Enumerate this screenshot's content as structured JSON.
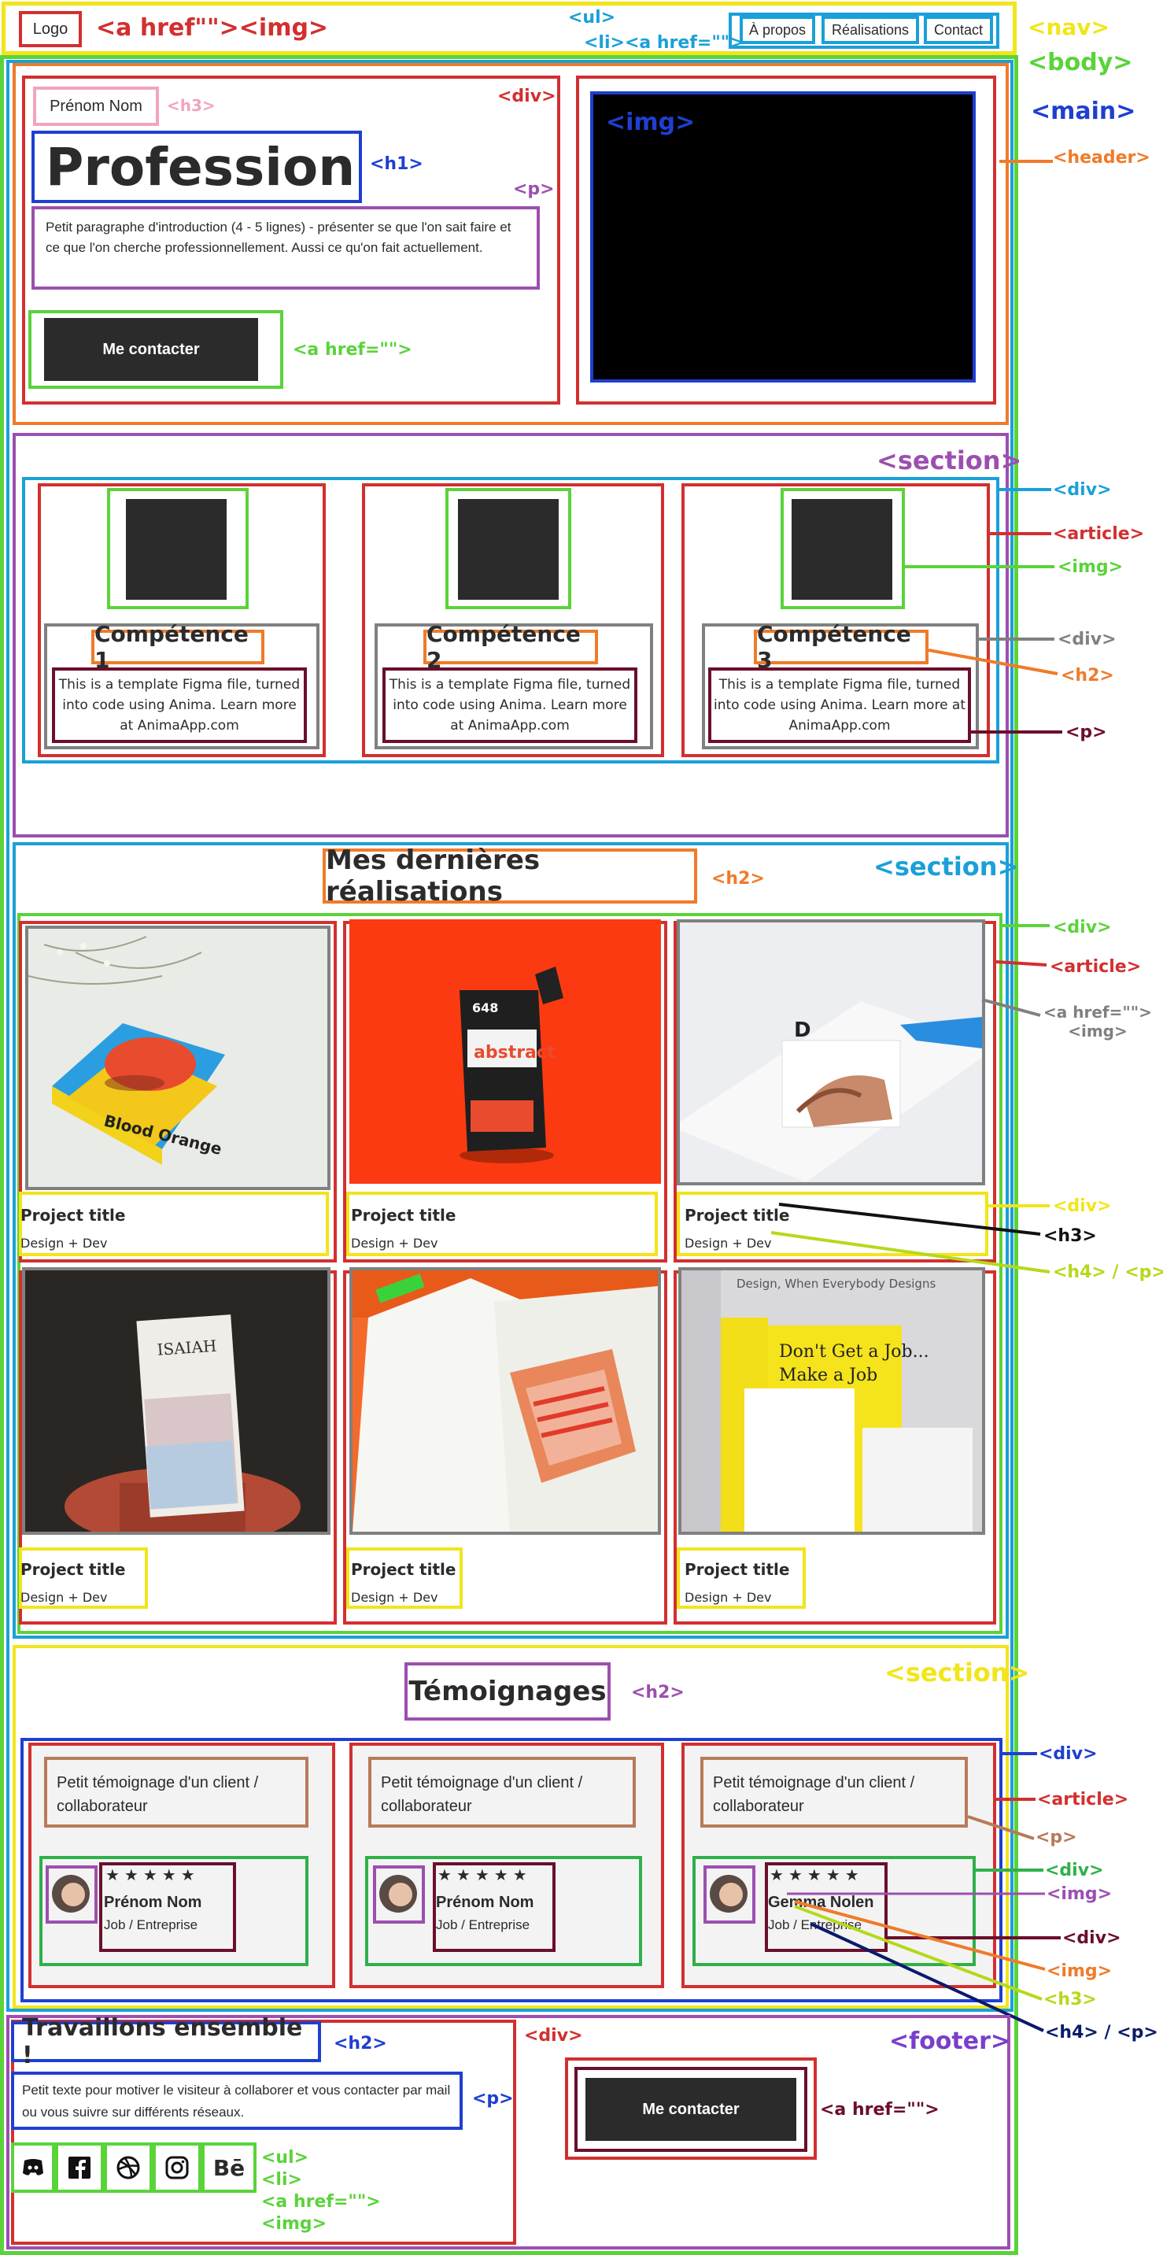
{
  "nav": {
    "logo": "Logo",
    "logo_tag": "<a href\"\"><img>",
    "ul_tag": "<ul>",
    "li_tag": "<li><a href=\"\">",
    "links": [
      "À propos",
      "Réalisations",
      "Contact"
    ],
    "nav_tag": "<nav>",
    "body_tag": "<body>",
    "main_tag": "<main>",
    "header_tag": "<header>"
  },
  "header": {
    "name": "Prénom Nom",
    "h3_tag": "<h3>",
    "div_tag": "<div>",
    "profession": "Profession",
    "h1_tag": "<h1>",
    "p_tag": "<p>",
    "intro": "Petit paragraphe d'introduction (4 - 5 lignes) - présenter se que l'on sait faire et ce que l'on cherche professionnellement. Aussi ce qu'on fait actuellement.",
    "cta": "Me contacter",
    "cta_tag": "<a href=\"\">",
    "img_tag": "<img>"
  },
  "skills": {
    "section_tag": "<section>",
    "div_tag": "<div>",
    "article_tag": "<article>",
    "img_tag": "<img>",
    "inner_div_tag": "<div>",
    "h2_tag": "<h2>",
    "p_tag": "<p>",
    "items": [
      {
        "title": "Compétence 1",
        "text": "This is a template Figma file, turned into code using Anima. Learn more at AnimaApp.com"
      },
      {
        "title": "Compétence 2",
        "text": "This is a template Figma file, turned into code using Anima. Learn more at AnimaApp.com"
      },
      {
        "title": "Compétence 3",
        "text": "This is a template Figma file, turned into code using Anima. Learn more at AnimaApp.com"
      }
    ]
  },
  "works": {
    "title": "Mes dernières réalisations",
    "h2_tag": "<h2>",
    "section_tag": "<section>",
    "div_tag": "<div>",
    "article_tag": "<article>",
    "link_img_tag": "<a href=\"\">\n<img>",
    "info_div_tag": "<div>",
    "h3_tag": "<h3>",
    "h4p_tag": "<h4> / <p>",
    "projects": [
      {
        "title": "Project title",
        "sub": "Design + Dev",
        "photo": "blood-orange-book"
      },
      {
        "title": "Project title",
        "sub": "Design + Dev",
        "photo": "abstract-paint-pouch"
      },
      {
        "title": "Project title",
        "sub": "Design + Dev",
        "photo": "hand-on-paper"
      },
      {
        "title": "Project title",
        "sub": "Design + Dev",
        "photo": "isaiah-book"
      },
      {
        "title": "Project title",
        "sub": "Design + Dev",
        "photo": "open-magazine"
      },
      {
        "title": "Project title",
        "sub": "Design + Dev",
        "photo": "design-books"
      }
    ],
    "book_label": "Blood Orange",
    "pouch_brand": "abstract",
    "pouch_num": "648",
    "isaiah": "ISAIAH",
    "yellow_book_1": "Don't Get a Job...",
    "yellow_book_2": "Make a Job",
    "design_title": "Design, When Everybody Designs"
  },
  "testimonials": {
    "title": "Témoignages",
    "h2_tag": "<h2>",
    "section_tag": "<section>",
    "div_tag": "<div>",
    "article_tag": "<article>",
    "p_tag": "<p>",
    "inner_div_tag": "<div>",
    "img_tag": "<img>",
    "div2_tag": "<div>",
    "img2_tag": "<img>",
    "h3_tag": "<h3>",
    "h4p_tag": "<h4> / <p>",
    "items": [
      {
        "quote": "Petit témoignage d'un client / collaborateur",
        "stars": "★★★★★",
        "name": "Prénom Nom",
        "job": "Job / Entreprise"
      },
      {
        "quote": "Petit témoignage d'un client / collaborateur",
        "stars": "★★★★★",
        "name": "Prénom Nom",
        "job": "Job / Entreprise"
      },
      {
        "quote": "Petit témoignage d'un client / collaborateur",
        "stars": "★★★★★",
        "name": "Gemma Nolen",
        "job": "Job / Entreprise"
      }
    ]
  },
  "footer": {
    "title": "Travaillons ensemble !",
    "h2_tag": "<h2>",
    "div_tag": "<div>",
    "footer_tag": "<footer>",
    "text": "Petit texte pour motiver le visiteur à collaborer et vous contacter par mail ou vous suivre sur différents réseaux.",
    "p_tag": "<p>",
    "list_tags": "<ul>\n<li>\n<a href=\"\">\n<img>",
    "cta": "Me contacter",
    "cta_tag": "<a href=\"\">",
    "socials": [
      "discord-icon",
      "facebook-icon",
      "dribbble-icon",
      "instagram-icon",
      "behance-icon"
    ],
    "behance_text": "Bē"
  },
  "colors": {
    "red": "#d32f2f",
    "yellow": "#f2e51a",
    "green": "#5ad33a",
    "blue": "#1f3fd1",
    "cyan": "#1aa0d8",
    "orange": "#ef7b2a",
    "purple": "#9c4fb0",
    "grey": "#808080",
    "maroon": "#6b0f2a",
    "pink": "#f3a3c0",
    "lime": "#b4d91a",
    "navy": "#0a1a6b",
    "brown": "#b87a5a"
  }
}
